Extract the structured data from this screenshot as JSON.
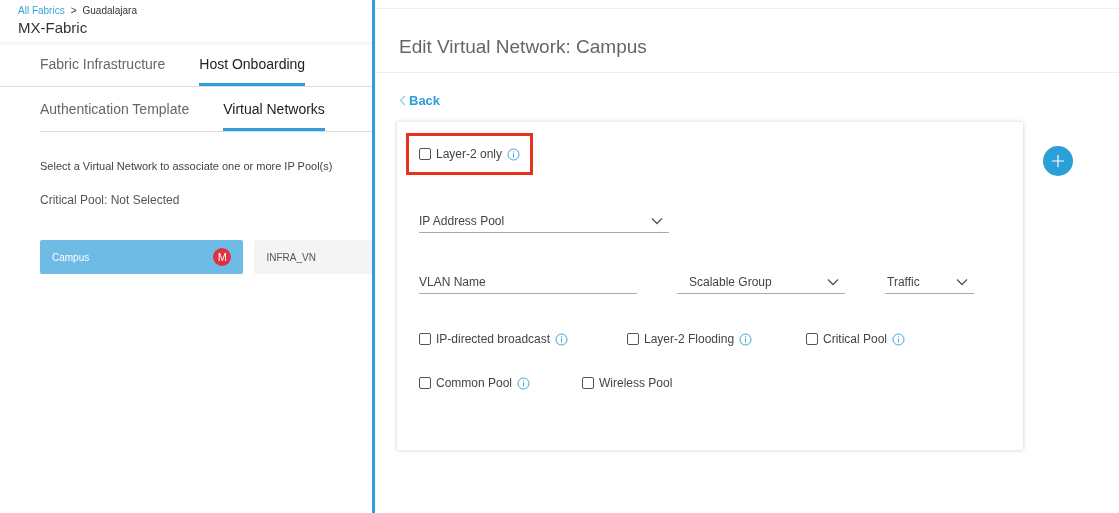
{
  "breadcrumb": {
    "link": "All Fabrics",
    "separator": ">",
    "current": "Guadalajara"
  },
  "fabric_title": "MX-Fabric",
  "tabs": [
    {
      "label": "Fabric Infrastructure",
      "selected": false
    },
    {
      "label": "Host Onboarding",
      "selected": true
    }
  ],
  "subtabs": [
    {
      "label": "Authentication Template",
      "selected": false
    },
    {
      "label": "Virtual Networks",
      "selected": true
    }
  ],
  "instructions": "Select a Virtual Network to associate one or more IP Pool(s)",
  "critical_pool_status": "Critical Pool: Not Selected",
  "virtual_networks": [
    {
      "name": "Campus",
      "selected": true,
      "badge": "M"
    },
    {
      "name": "INFRA_VN",
      "selected": false
    }
  ],
  "panel": {
    "title": "Edit Virtual Network: Campus",
    "back": "Back",
    "layer2_only": {
      "label": "Layer-2 only",
      "checked": false,
      "info": true,
      "highlighted": true
    },
    "ip_pool": {
      "label": "IP Address Pool"
    },
    "vlan_name": {
      "placeholder": "VLAN Name"
    },
    "scalable_group": {
      "label": "Scalable Group"
    },
    "traffic": {
      "label": "Traffic"
    },
    "option_rows": [
      [
        {
          "label": "IP-directed broadcast",
          "checked": false,
          "info": true
        },
        {
          "label": "Layer-2 Flooding",
          "checked": false,
          "info": true
        },
        {
          "label": "Critical Pool",
          "checked": false,
          "info": true
        }
      ],
      [
        {
          "label": "Common Pool",
          "checked": false,
          "info": true
        },
        {
          "label": "Wireless Pool",
          "checked": false,
          "info": false
        }
      ]
    ]
  }
}
